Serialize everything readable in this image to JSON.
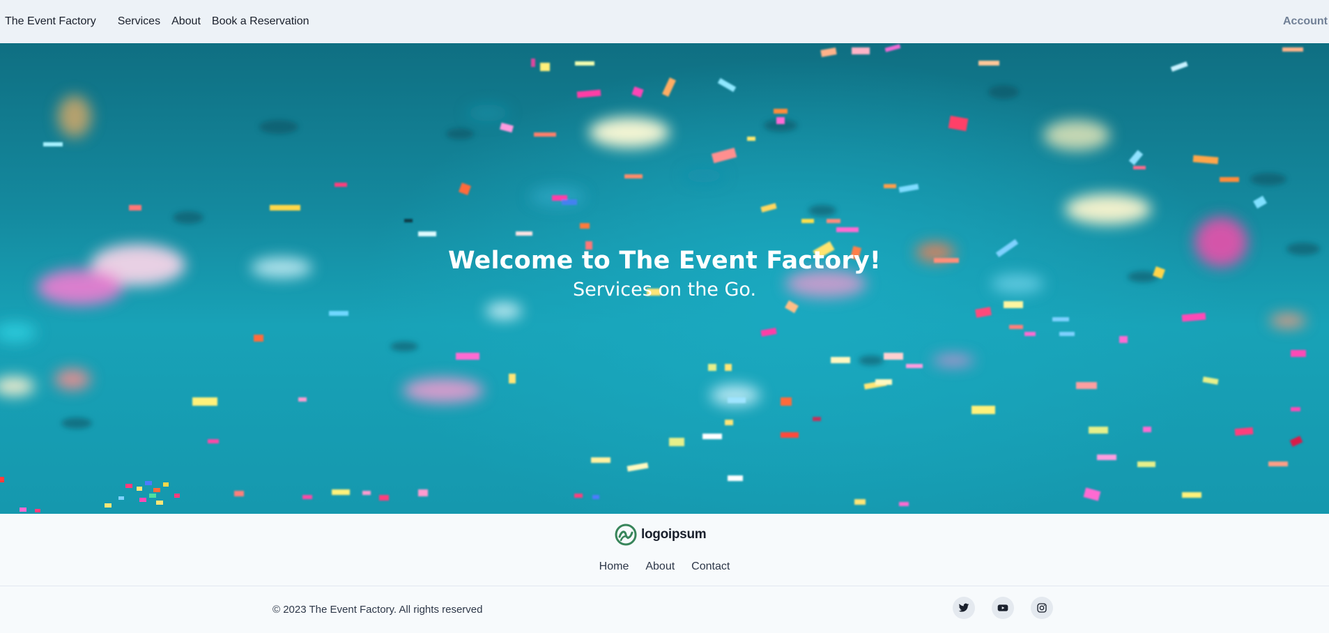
{
  "nav": {
    "brand": "The Event Factory",
    "links": [
      "Services",
      "About",
      "Book a Reservation"
    ],
    "account": "Account"
  },
  "hero": {
    "title": "Welcome to The Event Factory!",
    "subtitle": "Services on the Go."
  },
  "footer": {
    "logo_text": "logoipsum",
    "links": [
      "Home",
      "About",
      "Contact"
    ],
    "copyright": "© 2023 The Event Factory. All rights reserved",
    "socials": [
      "twitter-icon",
      "youtube-icon",
      "instagram-icon"
    ]
  },
  "colors": {
    "nav_bg": "#edf2f7",
    "hero_teal": "#18a2b7",
    "logo_green": "#38855a",
    "account_gray": "#718096"
  }
}
